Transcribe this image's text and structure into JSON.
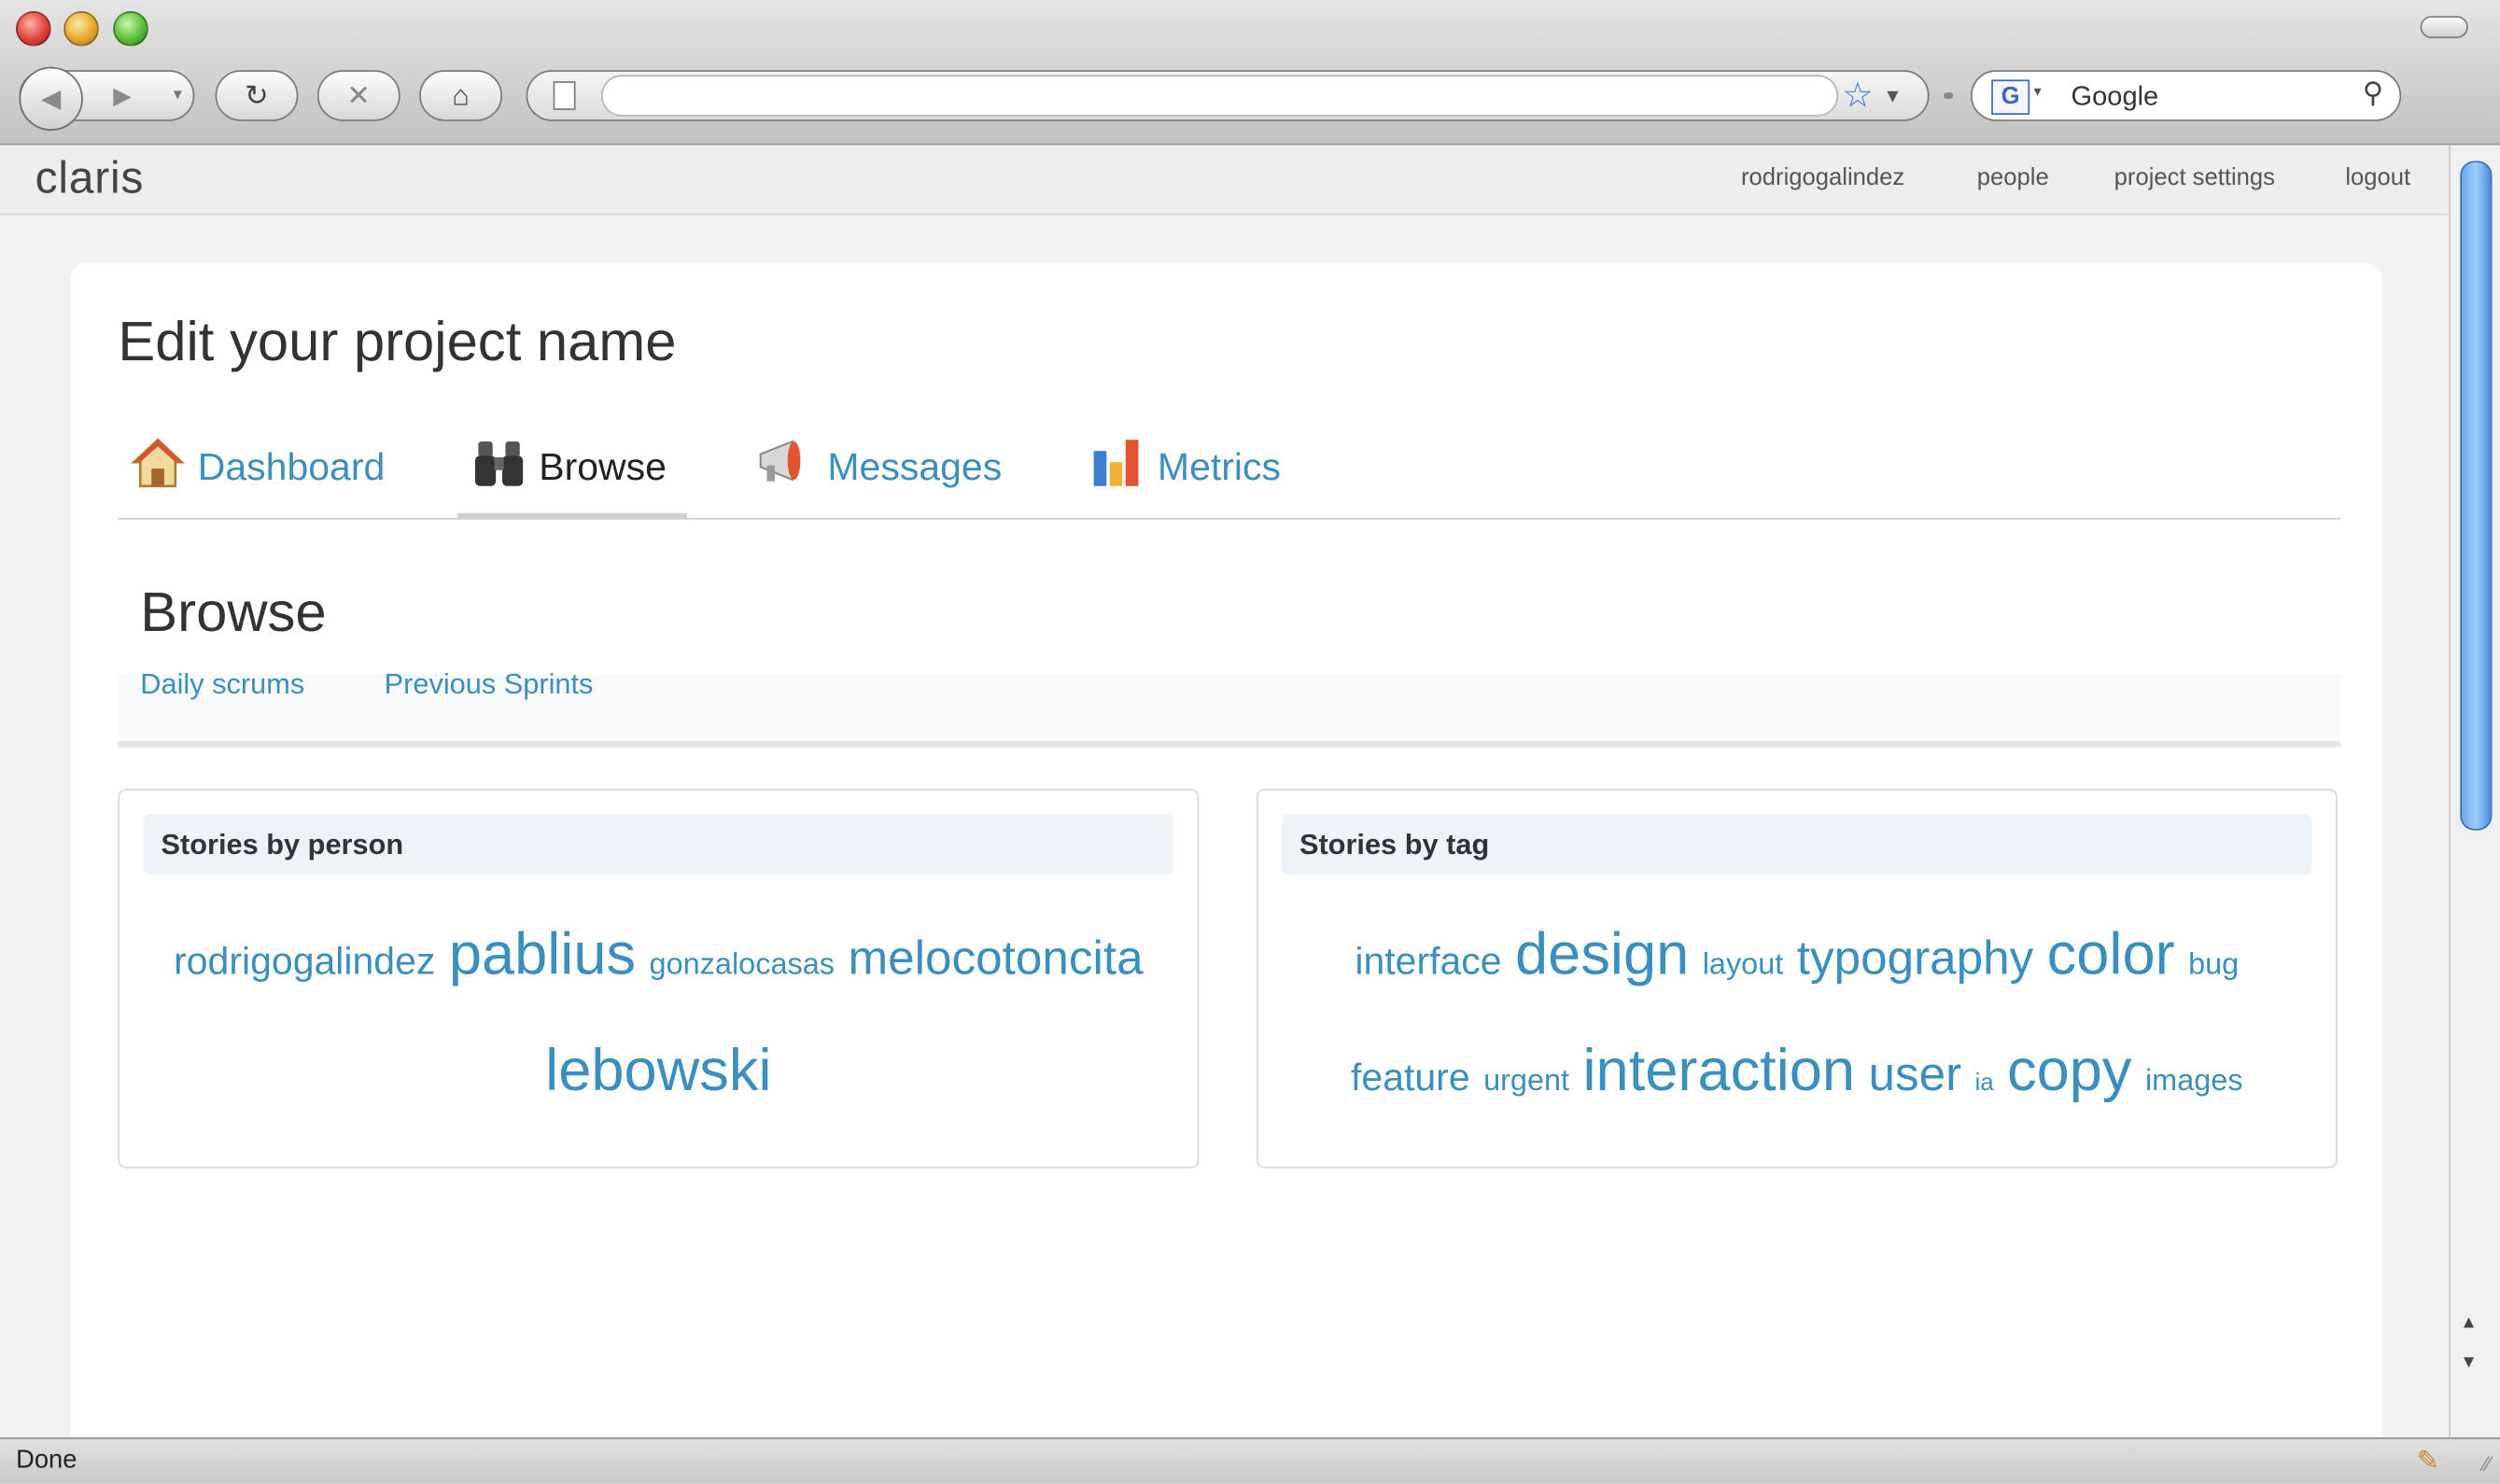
{
  "browser": {
    "search_placeholder": "Google",
    "status": "Done"
  },
  "app": {
    "brand": "claris",
    "topnav": [
      "rodrigogalindez",
      "people",
      "project settings",
      "logout"
    ]
  },
  "project": {
    "title": "Edit your project name"
  },
  "tabs": [
    {
      "label": "Dashboard",
      "icon": "house-icon",
      "active": false
    },
    {
      "label": "Browse",
      "icon": "binoculars-icon",
      "active": true
    },
    {
      "label": "Messages",
      "icon": "megaphone-icon",
      "active": false
    },
    {
      "label": "Metrics",
      "icon": "bar-chart-icon",
      "active": false
    }
  ],
  "browse": {
    "title": "Browse",
    "links": [
      "Daily scrums",
      "Previous Sprints"
    ]
  },
  "panels": {
    "people": {
      "title": "Stories by person",
      "items": [
        {
          "text": "rodrigogalindez",
          "weight": 2
        },
        {
          "text": "pablius",
          "weight": 4
        },
        {
          "text": "gonzalocasas",
          "weight": 1
        },
        {
          "text": "melocotoncita",
          "weight": 3
        },
        {
          "text": "lebowski",
          "weight": 4
        }
      ]
    },
    "tags": {
      "title": "Stories by tag",
      "items": [
        {
          "text": "interface",
          "weight": 2
        },
        {
          "text": "design",
          "weight": 4
        },
        {
          "text": "layout",
          "weight": 1
        },
        {
          "text": "typography",
          "weight": 3
        },
        {
          "text": "color",
          "weight": 4
        },
        {
          "text": "bug",
          "weight": 1
        },
        {
          "text": "feature",
          "weight": 2
        },
        {
          "text": "urgent",
          "weight": 1
        },
        {
          "text": "interaction",
          "weight": 4
        },
        {
          "text": "user",
          "weight": 3
        },
        {
          "text": "ia",
          "weight": 0
        },
        {
          "text": "copy",
          "weight": 4
        },
        {
          "text": "images",
          "weight": 1
        }
      ]
    }
  },
  "colors": {
    "link": "#3a8fc0",
    "text": "#333333"
  }
}
